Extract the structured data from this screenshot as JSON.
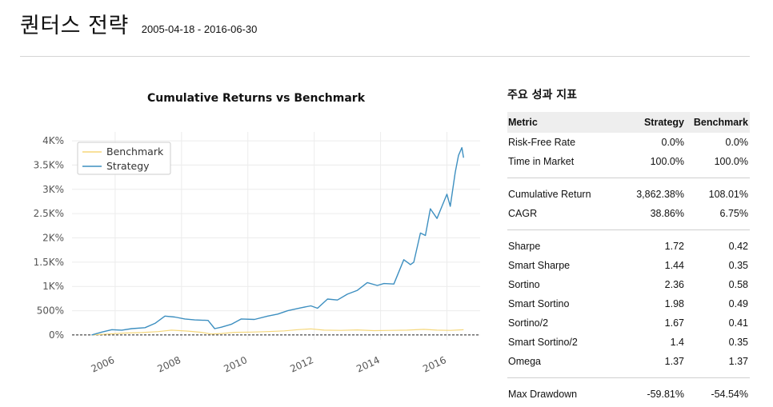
{
  "header": {
    "title": "퀀터스 전략",
    "date_range": "2005-04-18 - 2016-06-30"
  },
  "chart_data": {
    "type": "line",
    "title": "Cumulative Returns vs Benchmark",
    "xlabel": "",
    "ylabel": "",
    "xlim": [
      2004.7,
      2017.0
    ],
    "ylim": [
      -100,
      4100
    ],
    "x_ticks": [
      2006,
      2008,
      2010,
      2012,
      2014,
      2016
    ],
    "x_tick_labels": [
      "2006",
      "2008",
      "2010",
      "2012",
      "2014",
      "2016"
    ],
    "y_ticks": [
      0,
      500,
      1000,
      1500,
      2000,
      2500,
      3000,
      3500,
      4000
    ],
    "y_tick_labels": [
      "0%",
      "500%",
      "1K%",
      "1.5K%",
      "2K%",
      "2.5K%",
      "3K%",
      "3.5K%",
      "4K%"
    ],
    "grid": true,
    "legend_position": "top-left",
    "series": [
      {
        "name": "Benchmark",
        "color": "#f5d77a",
        "x": [
          2005.29,
          2005.8,
          2006.3,
          2006.8,
          2007.3,
          2007.7,
          2008.2,
          2008.6,
          2008.9,
          2009.2,
          2009.6,
          2010.1,
          2010.6,
          2011.1,
          2011.5,
          2011.9,
          2012.3,
          2012.8,
          2013.3,
          2013.8,
          2014.3,
          2014.8,
          2015.3,
          2015.7,
          2016.1,
          2016.5
        ],
        "y": [
          0,
          20,
          40,
          50,
          70,
          100,
          80,
          55,
          20,
          30,
          55,
          60,
          70,
          85,
          110,
          125,
          100,
          95,
          105,
          90,
          95,
          100,
          115,
          100,
          95,
          108
        ]
      },
      {
        "name": "Strategy",
        "color": "#3d8fc0",
        "x": [
          2005.29,
          2005.6,
          2005.9,
          2006.2,
          2006.5,
          2006.9,
          2007.2,
          2007.5,
          2007.8,
          2008.1,
          2008.4,
          2008.8,
          2009.0,
          2009.2,
          2009.5,
          2009.8,
          2010.2,
          2010.6,
          2010.9,
          2011.2,
          2011.6,
          2011.9,
          2012.1,
          2012.4,
          2012.7,
          2013.0,
          2013.3,
          2013.6,
          2013.9,
          2014.1,
          2014.4,
          2014.7,
          2014.9,
          2015.0,
          2015.2,
          2015.35,
          2015.5,
          2015.7,
          2015.85,
          2016.0,
          2016.1,
          2016.25,
          2016.35,
          2016.45,
          2016.5
        ],
        "y": [
          0,
          60,
          110,
          100,
          130,
          150,
          240,
          390,
          370,
          330,
          310,
          300,
          130,
          160,
          220,
          330,
          320,
          390,
          430,
          500,
          560,
          600,
          550,
          740,
          720,
          840,
          920,
          1080,
          1020,
          1060,
          1050,
          1550,
          1450,
          1500,
          2100,
          2050,
          2600,
          2400,
          2650,
          2900,
          2650,
          3350,
          3700,
          3860,
          3650
        ]
      }
    ]
  },
  "metrics": {
    "title": "주요 성과 지표",
    "headers": {
      "metric": "Metric",
      "strategy": "Strategy",
      "benchmark": "Benchmark"
    },
    "groups": [
      [
        {
          "name": "Risk-Free Rate",
          "strategy": "0.0%",
          "benchmark": "0.0%"
        },
        {
          "name": "Time in Market",
          "strategy": "100.0%",
          "benchmark": "100.0%"
        }
      ],
      [
        {
          "name": "Cumulative Return",
          "strategy": "3,862.38%",
          "benchmark": "108.01%"
        },
        {
          "name": "CAGR",
          "strategy": "38.86%",
          "benchmark": "6.75%"
        }
      ],
      [
        {
          "name": "Sharpe",
          "strategy": "1.72",
          "benchmark": "0.42"
        },
        {
          "name": "Smart Sharpe",
          "strategy": "1.44",
          "benchmark": "0.35"
        },
        {
          "name": "Sortino",
          "strategy": "2.36",
          "benchmark": "0.58"
        },
        {
          "name": "Smart Sortino",
          "strategy": "1.98",
          "benchmark": "0.49"
        },
        {
          "name": "Sortino/2",
          "strategy": "1.67",
          "benchmark": "0.41"
        },
        {
          "name": "Smart Sortino/2",
          "strategy": "1.4",
          "benchmark": "0.35"
        },
        {
          "name": "Omega",
          "strategy": "1.37",
          "benchmark": "1.37"
        }
      ],
      [
        {
          "name": "Max Drawdown",
          "strategy": "-59.81%",
          "benchmark": "-54.54%"
        }
      ]
    ]
  }
}
